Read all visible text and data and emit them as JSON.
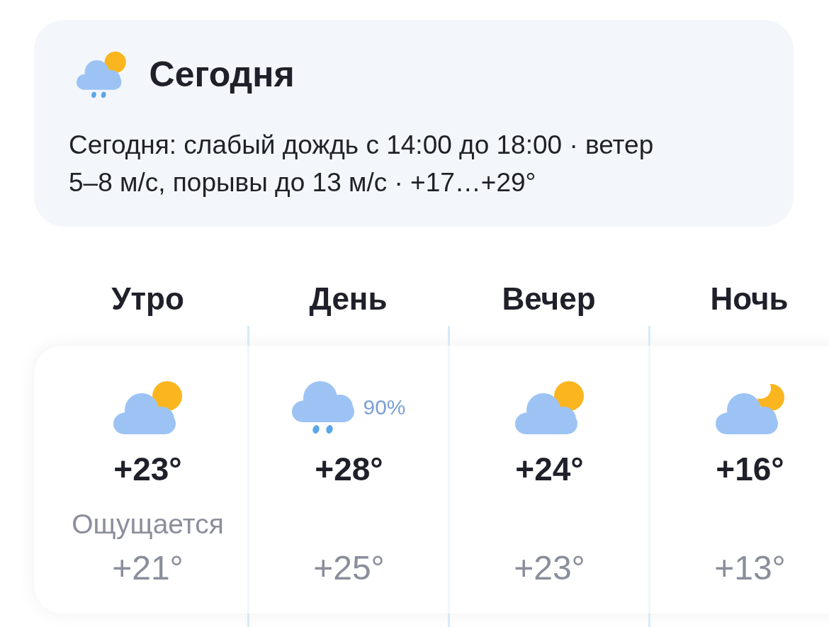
{
  "today": {
    "title": "Сегодня",
    "kind": "partly_cloudy_rain",
    "summary": "Сегодня: слабый дождь с 14:00 до 18:00 · ветер 5–8 м/с, порывы до 13 м/с · +17…+29°"
  },
  "periods": [
    {
      "label": "Утро",
      "kind": "partly_cloudy",
      "temp": "+23°",
      "feels_like_label": "Ощущается",
      "feels_like": "+21°"
    },
    {
      "label": "День",
      "kind": "rain",
      "precipitation": "90%",
      "temp": "+28°",
      "feels_like": "+25°"
    },
    {
      "label": "Вечер",
      "kind": "partly_cloudy",
      "temp": "+24°",
      "feels_like": "+23°"
    },
    {
      "label": "Ночь",
      "kind": "partly_cloudy_night",
      "temp": "+16°",
      "feels_like": "+13°"
    }
  ]
}
